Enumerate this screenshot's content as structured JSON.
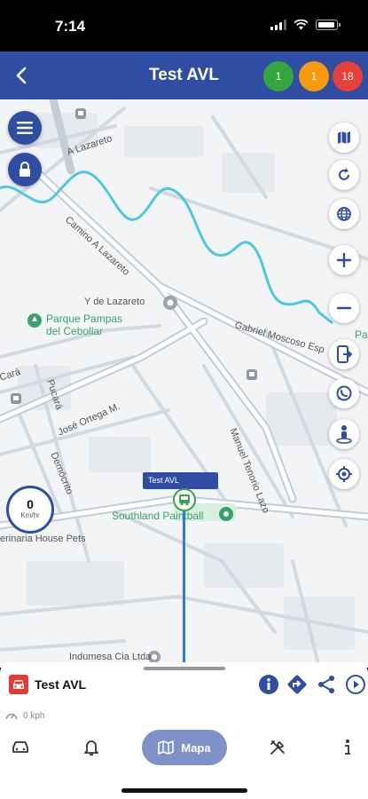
{
  "status_bar": {
    "time": "7:14"
  },
  "header": {
    "title": "Test AVL",
    "badges": [
      {
        "value": "1",
        "color": "#35a63b"
      },
      {
        "value": "1",
        "color": "#f79a0e"
      },
      {
        "value": "18",
        "color": "#e8403a"
      }
    ]
  },
  "map": {
    "labels": {
      "a_lazareto": "A Lazareto",
      "camino": "Camino A Lazareto",
      "y_lazareto": "Y de Lazareto",
      "parque": "Parque Pampas",
      "parque2": "del Cebollar",
      "gabriel": "Gabriel Moscoso Esp",
      "pa": "Pa",
      "cara": "Cará",
      "pucara": "Pucará",
      "jose": "José Ortega M.",
      "democrito": "Demócrito",
      "manuel": "Manuel Tenorio Lazo",
      "southland": "Southland Paintball",
      "veterinaria": "erinaria House Pets",
      "indumesa": "Indumesa Cia Ltda"
    },
    "speedometer": {
      "value": "0",
      "unit": "Km/hr"
    },
    "vehicle_tag": "Test AVL"
  },
  "panel": {
    "vehicle_name": "Test AVL",
    "speed": "0 kph"
  },
  "tabs": {
    "active_label": "Mapa"
  }
}
